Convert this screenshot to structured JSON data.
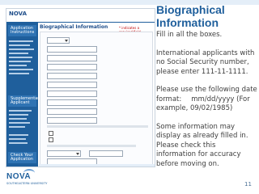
{
  "slide": {
    "title": "Biographical Information",
    "paragraphs": [
      "Fill in all the boxes.",
      "International applicants with no Social Security number, please enter 111-11-1111.",
      "Please use the following date format:\tmm/dd/yyyy (For example, 09/02/1985)",
      "Some information may display as already filled in. Please check this information for accuracy before moving on."
    ],
    "page_number": "11"
  },
  "logo": {
    "name": "NOVA",
    "subtitle": "SOUTHEASTERN UNIVERSITY"
  },
  "screenshot": {
    "header_logo": "NOVA",
    "form_title": "Biographical Information",
    "required_note": "* indicates a required field",
    "sidebar_items": [
      "Application Instructions",
      "Supplementary Applicant",
      "Check Your Application"
    ]
  },
  "colors": {
    "accent": "#1f5f9c",
    "text": "#404040",
    "nav": "#1f5f9c"
  }
}
